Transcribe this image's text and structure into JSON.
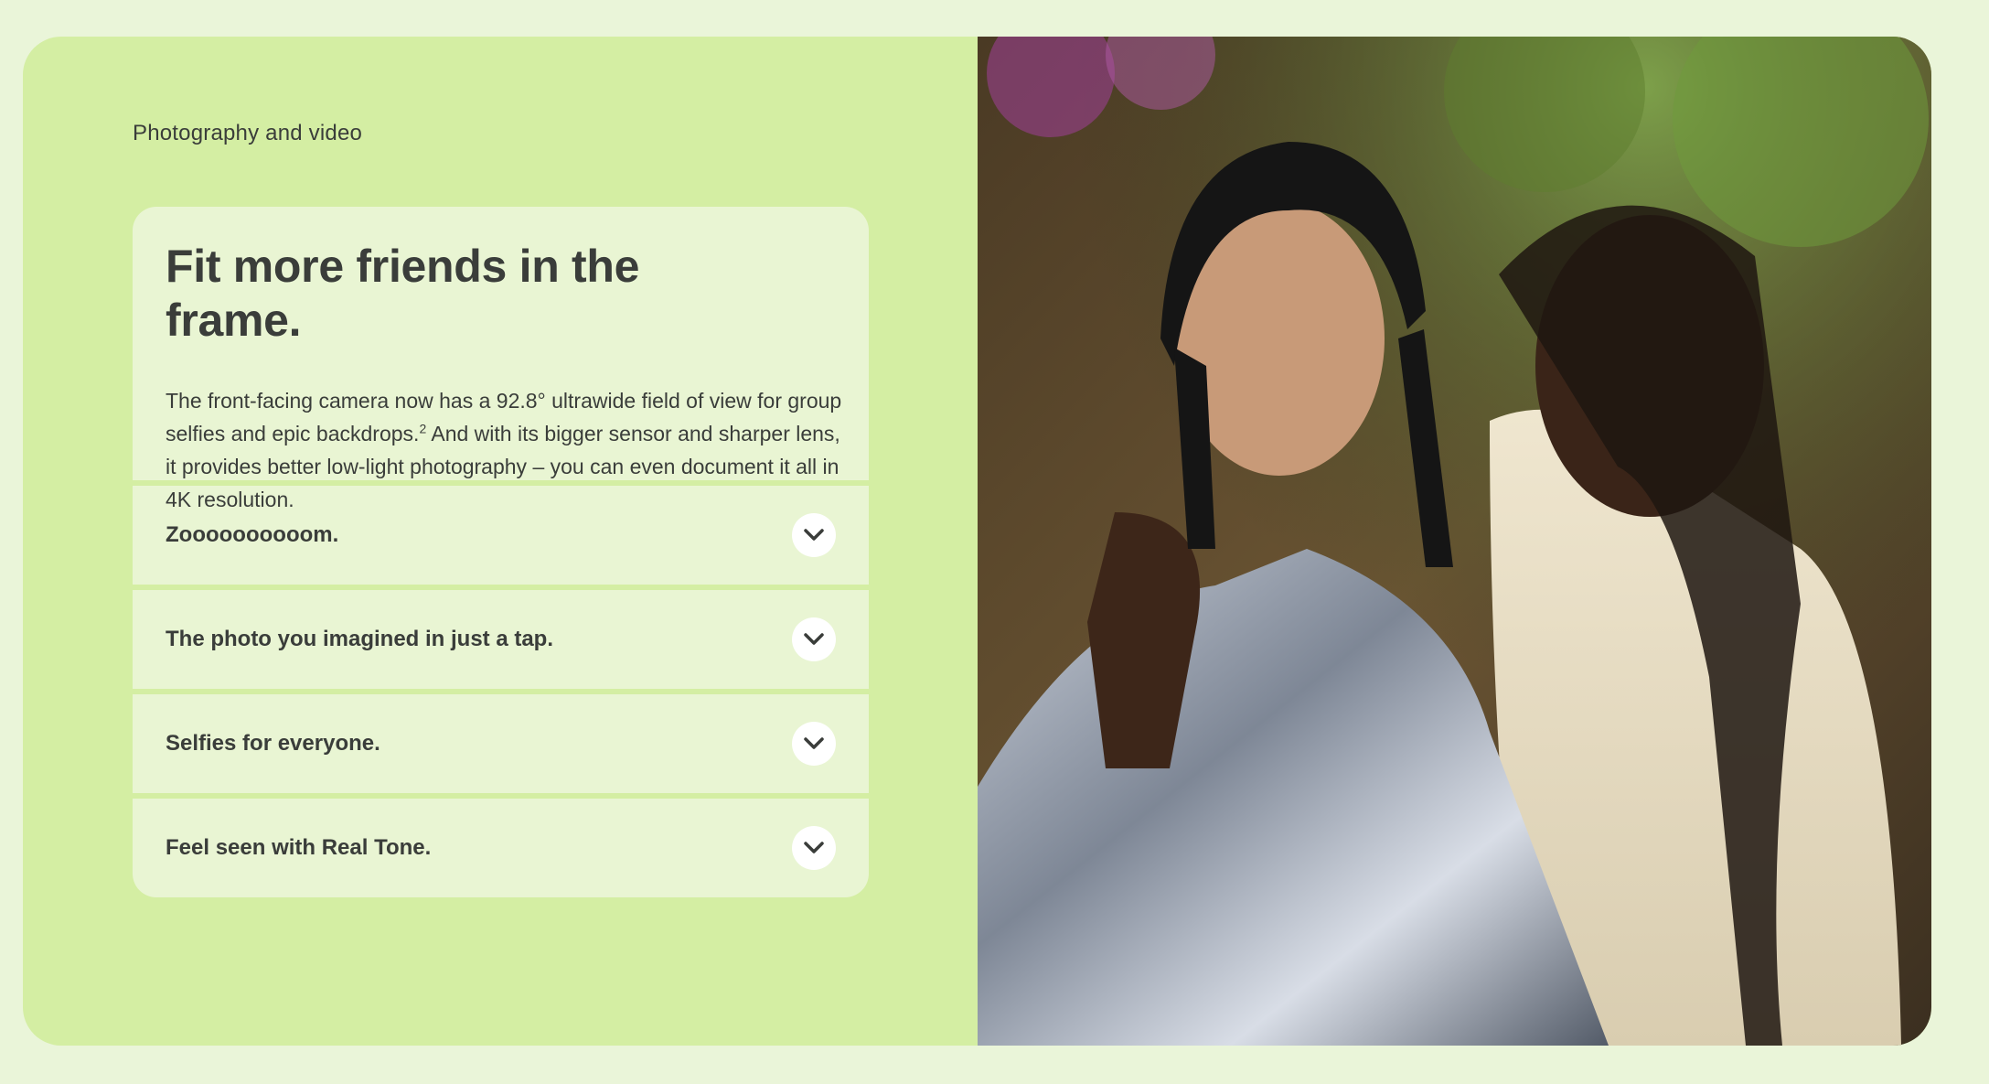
{
  "section": {
    "label": "Photography and video"
  },
  "feature": {
    "headline": "Fit more friends in the frame.",
    "body_part1": "The front-facing camera now has a 92.8° ultrawide field of view for group selfies and epic backdrops.",
    "footnote": "2",
    "body_part2": " And with its bigger sensor and sharper lens, it provides better low-light photography – you can even document it all in 4K resolution."
  },
  "accordion": {
    "items": [
      {
        "label": "Zoooooooooom."
      },
      {
        "label": "The photo you imagined in just a tap."
      },
      {
        "label": "Selfies for everyone."
      },
      {
        "label": "Feel seen with Real Tone."
      }
    ]
  },
  "icons": {
    "expand": "chevron-down-icon"
  },
  "colors": {
    "page_bg": "#eaf5d9",
    "panel_bg": "#d4eea3",
    "card_bg": "#e9f5d3",
    "text": "#3a3d3a",
    "chevron_bg": "#ffffff"
  }
}
